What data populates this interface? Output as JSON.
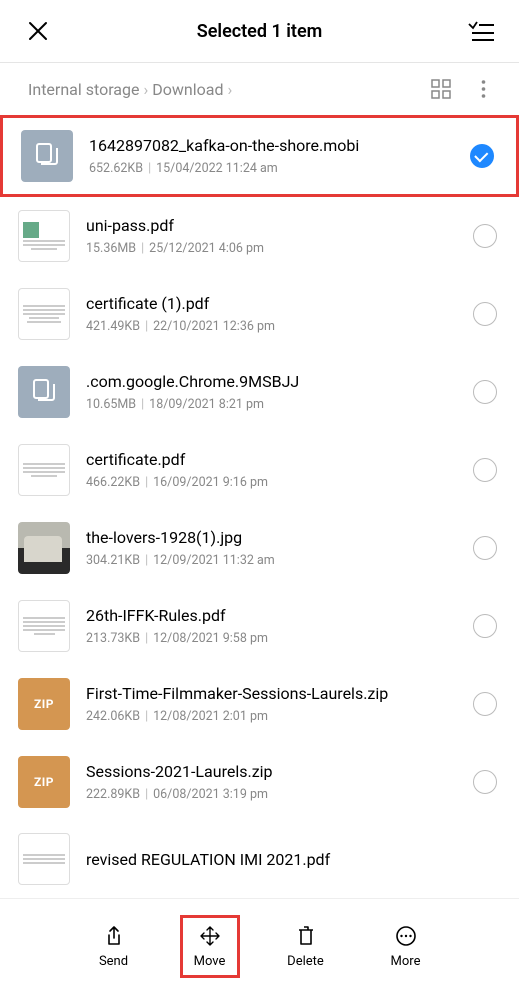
{
  "header": {
    "title": "Selected 1 item"
  },
  "breadcrumb": {
    "root": "Internal storage",
    "folder": "Download"
  },
  "files": [
    {
      "name": "1642897082_kafka-on-the-shore.mobi",
      "size": "652.62KB",
      "date": "15/04/2022 11:24 am"
    },
    {
      "name": "uni-pass.pdf",
      "size": "15.36MB",
      "date": "25/12/2021 4:06 pm"
    },
    {
      "name": "certificate (1).pdf",
      "size": "421.49KB",
      "date": "22/10/2021 12:36 pm"
    },
    {
      "name": ".com.google.Chrome.9MSBJJ",
      "size": "10.65MB",
      "date": "18/09/2021 8:21 pm"
    },
    {
      "name": "certificate.pdf",
      "size": "466.22KB",
      "date": "16/09/2021 9:16 pm"
    },
    {
      "name": "the-lovers-1928(1).jpg",
      "size": "304.21KB",
      "date": "12/09/2021 11:32 am"
    },
    {
      "name": "26th-IFFK-Rules.pdf",
      "size": "213.73KB",
      "date": "12/08/2021 9:58 pm"
    },
    {
      "name": "First-Time-Filmmaker-Sessions-Laurels.zip",
      "size": "242.06KB",
      "date": "12/08/2021 2:01 pm"
    },
    {
      "name": "Sessions-2021-Laurels.zip",
      "size": "222.89KB",
      "date": "06/08/2021 3:19 pm"
    },
    {
      "name": "revised REGULATION IMI 2021.pdf",
      "size": "",
      "date": ""
    }
  ],
  "zip_label": "ZIP",
  "actions": {
    "send": "Send",
    "move": "Move",
    "delete": "Delete",
    "more": "More"
  }
}
